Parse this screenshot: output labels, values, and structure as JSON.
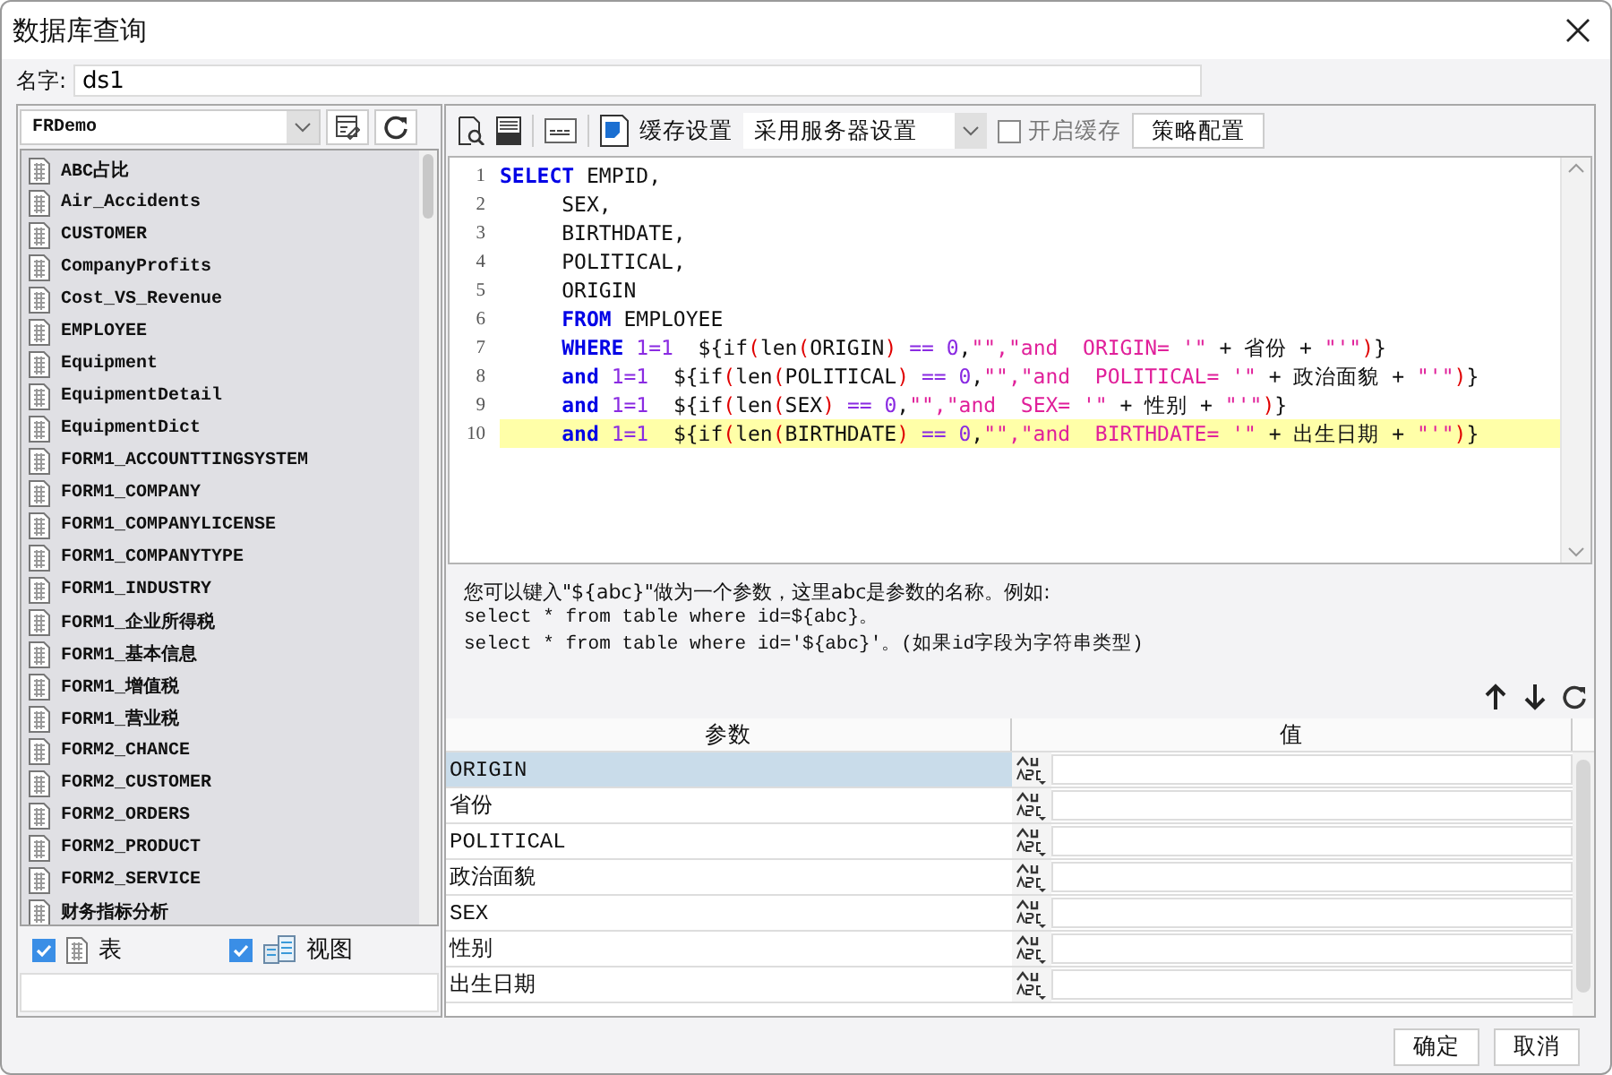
{
  "window": {
    "title": "数据库查询"
  },
  "name_field": {
    "label": "名字:",
    "value": "ds1"
  },
  "connection": {
    "value": "FRDemo"
  },
  "tables": [
    "ABC占比",
    "Air_Accidents",
    "CUSTOMER",
    "CompanyProfits",
    "Cost_VS_Revenue",
    "EMPLOYEE",
    "Equipment",
    "EquipmentDetail",
    "EquipmentDict",
    "FORM1_ACCOUNTTINGSYSTEM",
    "FORM1_COMPANY",
    "FORM1_COMPANYLICENSE",
    "FORM1_COMPANYTYPE",
    "FORM1_INDUSTRY",
    "FORM1_企业所得税",
    "FORM1_基本信息",
    "FORM1_增值税",
    "FORM1_营业税",
    "FORM2_CHANCE",
    "FORM2_CUSTOMER",
    "FORM2_ORDERS",
    "FORM2_PRODUCT",
    "FORM2_SERVICE",
    "财务指标分析"
  ],
  "filters": [
    {
      "kind": "table",
      "label": "表",
      "checked": true
    },
    {
      "kind": "view",
      "label": "视图",
      "checked": true
    }
  ],
  "toolbar": {
    "cache_label": "缓存设置",
    "cache_mode": "采用服务器设置",
    "enable_cache": {
      "label": "开启缓存",
      "checked": false,
      "disabled": true
    },
    "strategy_button": "策略配置"
  },
  "editor": {
    "lines": [
      {
        "number": "1",
        "highlighted": false,
        "tokens": [
          {
            "kind": "kw",
            "t": "SELECT"
          },
          {
            "kind": "plain",
            "t": " EMPID,"
          }
        ]
      },
      {
        "number": "2",
        "highlighted": false,
        "tokens": [
          {
            "kind": "plain",
            "t": "     SEX,"
          }
        ]
      },
      {
        "number": "3",
        "highlighted": false,
        "tokens": [
          {
            "kind": "plain",
            "t": "     BIRTHDATE,"
          }
        ]
      },
      {
        "number": "4",
        "highlighted": false,
        "tokens": [
          {
            "kind": "plain",
            "t": "     POLITICAL,"
          }
        ]
      },
      {
        "number": "5",
        "highlighted": false,
        "tokens": [
          {
            "kind": "plain",
            "t": "     ORIGIN"
          }
        ]
      },
      {
        "number": "6",
        "highlighted": false,
        "tokens": [
          {
            "kind": "kw",
            "t": "     FROM"
          },
          {
            "kind": "plain",
            "t": " EMPLOYEE"
          }
        ]
      },
      {
        "number": "7",
        "highlighted": false,
        "tokens": [
          {
            "kind": "kw",
            "t": "     WHERE"
          },
          {
            "kind": "num",
            "t": " 1=1"
          },
          {
            "kind": "plain",
            "t": "  ${if"
          },
          {
            "kind": "paren",
            "t": "("
          },
          {
            "kind": "plain",
            "t": "len"
          },
          {
            "kind": "paren",
            "t": "("
          },
          {
            "kind": "plain",
            "t": "ORIGIN"
          },
          {
            "kind": "paren",
            "t": ")"
          },
          {
            "kind": "num",
            "t": " == 0"
          },
          {
            "kind": "plain",
            "t": ","
          },
          {
            "kind": "str",
            "t": "\"\",\"and  ORIGIN= '\""
          },
          {
            "kind": "plain",
            "t": " + 省份 + "
          },
          {
            "kind": "str",
            "t": "\"'\""
          },
          {
            "kind": "paren",
            "t": ")"
          },
          {
            "kind": "plain",
            "t": "}"
          }
        ]
      },
      {
        "number": "8",
        "highlighted": false,
        "tokens": [
          {
            "kind": "kw",
            "t": "     and"
          },
          {
            "kind": "num",
            "t": " 1=1"
          },
          {
            "kind": "plain",
            "t": "  ${if"
          },
          {
            "kind": "paren",
            "t": "("
          },
          {
            "kind": "plain",
            "t": "len"
          },
          {
            "kind": "paren",
            "t": "("
          },
          {
            "kind": "plain",
            "t": "POLITICAL"
          },
          {
            "kind": "paren",
            "t": ")"
          },
          {
            "kind": "num",
            "t": " == 0"
          },
          {
            "kind": "plain",
            "t": ","
          },
          {
            "kind": "str",
            "t": "\"\",\"and  POLITICAL= '\""
          },
          {
            "kind": "plain",
            "t": " + 政治面貌 + "
          },
          {
            "kind": "str",
            "t": "\"'\""
          },
          {
            "kind": "paren",
            "t": ")"
          },
          {
            "kind": "plain",
            "t": "}"
          }
        ]
      },
      {
        "number": "9",
        "highlighted": false,
        "tokens": [
          {
            "kind": "kw",
            "t": "     and"
          },
          {
            "kind": "num",
            "t": " 1=1"
          },
          {
            "kind": "plain",
            "t": "  ${if"
          },
          {
            "kind": "paren",
            "t": "("
          },
          {
            "kind": "plain",
            "t": "len"
          },
          {
            "kind": "paren",
            "t": "("
          },
          {
            "kind": "plain",
            "t": "SEX"
          },
          {
            "kind": "paren",
            "t": ")"
          },
          {
            "kind": "num",
            "t": " == 0"
          },
          {
            "kind": "plain",
            "t": ","
          },
          {
            "kind": "str",
            "t": "\"\",\"and  SEX= '\""
          },
          {
            "kind": "plain",
            "t": " + 性别 + "
          },
          {
            "kind": "str",
            "t": "\"'\""
          },
          {
            "kind": "paren",
            "t": ")"
          },
          {
            "kind": "plain",
            "t": "}"
          }
        ]
      },
      {
        "number": "10",
        "highlighted": true,
        "tokens": [
          {
            "kind": "kw",
            "t": "     and"
          },
          {
            "kind": "num",
            "t": " 1=1"
          },
          {
            "kind": "plain",
            "t": "  ${if"
          },
          {
            "kind": "paren",
            "t": "("
          },
          {
            "kind": "plain",
            "t": "len"
          },
          {
            "kind": "paren",
            "t": "("
          },
          {
            "kind": "plain",
            "t": "BIRTHDATE"
          },
          {
            "kind": "paren",
            "t": ")"
          },
          {
            "kind": "num",
            "t": " == 0"
          },
          {
            "kind": "plain",
            "t": ","
          },
          {
            "kind": "str",
            "t": "\"\",\"and  BIRTHDATE= '\""
          },
          {
            "kind": "plain",
            "t": " + 出生日期 + "
          },
          {
            "kind": "str",
            "t": "\"'\""
          },
          {
            "kind": "paren",
            "t": ")"
          },
          {
            "kind": "plain",
            "t": "}"
          }
        ]
      }
    ]
  },
  "hint": [
    "您可以键入\"${abc}\"做为一个参数，这里abc是参数的名称。例如:",
    "select * from table where id=${abc}。",
    "select * from table where id='${abc}'。(如果id字段为字符串类型)"
  ],
  "params": {
    "columns": [
      "参数",
      "值"
    ],
    "rows": [
      {
        "name": "ORIGIN",
        "selected": true
      },
      {
        "name": "省份",
        "selected": false
      },
      {
        "name": "POLITICAL",
        "selected": false
      },
      {
        "name": "政治面貌",
        "selected": false
      },
      {
        "name": "SEX",
        "selected": false
      },
      {
        "name": "性别",
        "selected": false
      },
      {
        "name": "出生日期",
        "selected": false
      }
    ]
  },
  "buttons": [
    "确定",
    "取消"
  ]
}
